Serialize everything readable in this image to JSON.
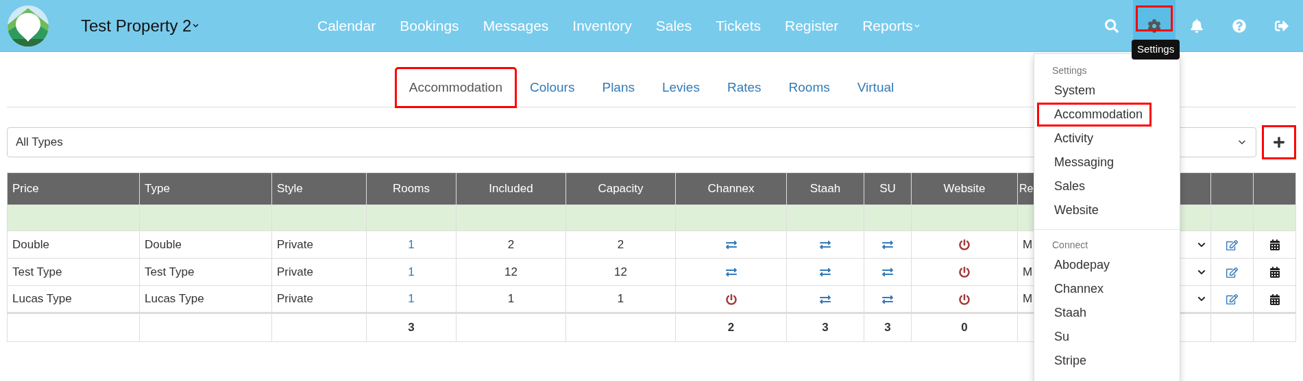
{
  "header": {
    "property": "Test Property 2",
    "nav": [
      {
        "label": "Calendar",
        "dropdown": false
      },
      {
        "label": "Bookings",
        "dropdown": false
      },
      {
        "label": "Messages",
        "dropdown": false
      },
      {
        "label": "Inventory",
        "dropdown": false
      },
      {
        "label": "Sales",
        "dropdown": false
      },
      {
        "label": "Tickets",
        "dropdown": false
      },
      {
        "label": "Register",
        "dropdown": false
      },
      {
        "label": "Reports",
        "dropdown": true
      }
    ],
    "icons": [
      {
        "kind": "search",
        "highlighted": false
      },
      {
        "kind": "settings",
        "highlighted": true
      },
      {
        "kind": "bell",
        "highlighted": false
      },
      {
        "kind": "help",
        "highlighted": false
      },
      {
        "kind": "logout",
        "highlighted": false
      }
    ],
    "tooltip": "Settings"
  },
  "tabs": [
    {
      "label": "Accommodation",
      "selected": true,
      "highlighted": true
    },
    {
      "label": "Colours",
      "selected": false,
      "highlighted": false
    },
    {
      "label": "Plans",
      "selected": false,
      "highlighted": false
    },
    {
      "label": "Levies",
      "selected": false,
      "highlighted": false
    },
    {
      "label": "Rates",
      "selected": false,
      "highlighted": false
    },
    {
      "label": "Rooms",
      "selected": false,
      "highlighted": false
    },
    {
      "label": "Virtual",
      "selected": false,
      "highlighted": false
    }
  ],
  "filter": {
    "value": "All Types"
  },
  "add_button": {
    "highlighted": true
  },
  "table": {
    "columns": [
      "Price",
      "Type",
      "Style",
      "Rooms",
      "Included",
      "Capacity",
      "Channex",
      "Staah",
      "SU",
      "Website",
      "Re"
    ],
    "rows": [
      {
        "cells": [
          {
            "kind": "text",
            "text": "Double"
          },
          {
            "kind": "text",
            "text": "Double"
          },
          {
            "kind": "text",
            "text": "Private"
          },
          {
            "kind": "link",
            "text": "1"
          },
          {
            "kind": "text",
            "text": "2"
          },
          {
            "kind": "text",
            "text": "2"
          },
          {
            "kind": "sync"
          },
          {
            "kind": "sync"
          },
          {
            "kind": "sync"
          },
          {
            "kind": "power"
          },
          {
            "kind": "select",
            "text": "M"
          },
          {
            "kind": "edit"
          },
          {
            "kind": "calendar"
          }
        ]
      },
      {
        "cells": [
          {
            "kind": "text",
            "text": "Test Type"
          },
          {
            "kind": "text",
            "text": "Test Type"
          },
          {
            "kind": "text",
            "text": "Private"
          },
          {
            "kind": "link",
            "text": "1"
          },
          {
            "kind": "text",
            "text": "12"
          },
          {
            "kind": "text",
            "text": "12"
          },
          {
            "kind": "sync"
          },
          {
            "kind": "sync"
          },
          {
            "kind": "sync"
          },
          {
            "kind": "power"
          },
          {
            "kind": "select",
            "text": "M"
          },
          {
            "kind": "edit"
          },
          {
            "kind": "calendar"
          }
        ]
      },
      {
        "cells": [
          {
            "kind": "text",
            "text": "Lucas Type"
          },
          {
            "kind": "text",
            "text": "Lucas Type"
          },
          {
            "kind": "text",
            "text": "Private"
          },
          {
            "kind": "link",
            "text": "1"
          },
          {
            "kind": "text",
            "text": "1"
          },
          {
            "kind": "text",
            "text": "1"
          },
          {
            "kind": "power"
          },
          {
            "kind": "sync"
          },
          {
            "kind": "sync"
          },
          {
            "kind": "power"
          },
          {
            "kind": "select",
            "text": "M"
          },
          {
            "kind": "edit"
          },
          {
            "kind": "calendar"
          }
        ]
      }
    ],
    "totals": [
      {
        "kind": "empty"
      },
      {
        "kind": "empty"
      },
      {
        "kind": "empty"
      },
      {
        "kind": "text",
        "text": "3"
      },
      {
        "kind": "empty"
      },
      {
        "kind": "empty"
      },
      {
        "kind": "text",
        "text": "2"
      },
      {
        "kind": "text",
        "text": "3"
      },
      {
        "kind": "text",
        "text": "3"
      },
      {
        "kind": "text",
        "text": "0"
      },
      {
        "kind": "empty"
      },
      {
        "kind": "empty"
      },
      {
        "kind": "empty"
      }
    ]
  },
  "menu": {
    "sections": [
      {
        "heading": "Settings",
        "items": [
          {
            "label": "System",
            "highlighted": false
          },
          {
            "label": "Accommodation",
            "highlighted": true
          },
          {
            "label": "Activity",
            "highlighted": false
          },
          {
            "label": "Messaging",
            "highlighted": false
          },
          {
            "label": "Sales",
            "highlighted": false
          },
          {
            "label": "Website",
            "highlighted": false
          }
        ]
      },
      {
        "heading": "Connect",
        "items": [
          {
            "label": "Abodepay",
            "highlighted": false
          },
          {
            "label": "Channex",
            "highlighted": false
          },
          {
            "label": "Staah",
            "highlighted": false
          },
          {
            "label": "Su",
            "highlighted": false
          },
          {
            "label": "Stripe",
            "highlighted": false
          }
        ]
      }
    ]
  }
}
